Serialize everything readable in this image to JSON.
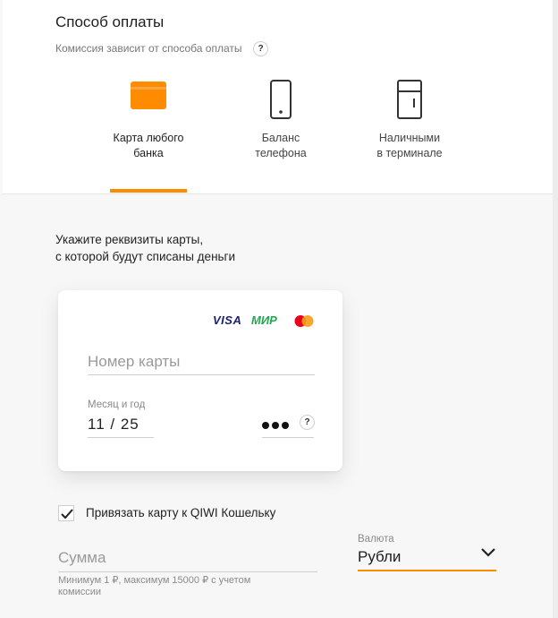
{
  "payment": {
    "title": "Способ оплаты",
    "subtitle": "Комиссия зависит от способа оплаты",
    "help": "?",
    "methods": [
      {
        "label_line1": "Карта любого",
        "label_line2": "банка",
        "icon": "bank-card-icon",
        "active": true
      },
      {
        "label_line1": "Баланс",
        "label_line2": "телефона",
        "icon": "phone-icon",
        "active": false
      },
      {
        "label_line1": "Наличными",
        "label_line2": "в терминале",
        "icon": "terminal-icon",
        "active": false
      }
    ]
  },
  "card_form": {
    "instruction_line1": "Укажите реквизиты карты,",
    "instruction_line2": "с которой будут списаны деньги",
    "brands": {
      "visa": "VISA",
      "mir": "МИР",
      "mastercard": "mastercard-logo"
    },
    "card_number_placeholder": "Номер карты",
    "expiry_label": "Месяц и год",
    "expiry_value": "11 / 25",
    "cvv_help": "?"
  },
  "link_wallet": {
    "checked": true,
    "label": "Привязать карту к QIWI Кошельку"
  },
  "amount": {
    "placeholder": "Сумма",
    "hint": "Минимум 1 ₽, максимум 15000 ₽ с учетом комиссии"
  },
  "currency": {
    "label": "Валюта",
    "value": "Рубли"
  },
  "colors": {
    "accent": "#ff8c00",
    "visa": "#1a1f71",
    "mir": "#1fa84f"
  }
}
